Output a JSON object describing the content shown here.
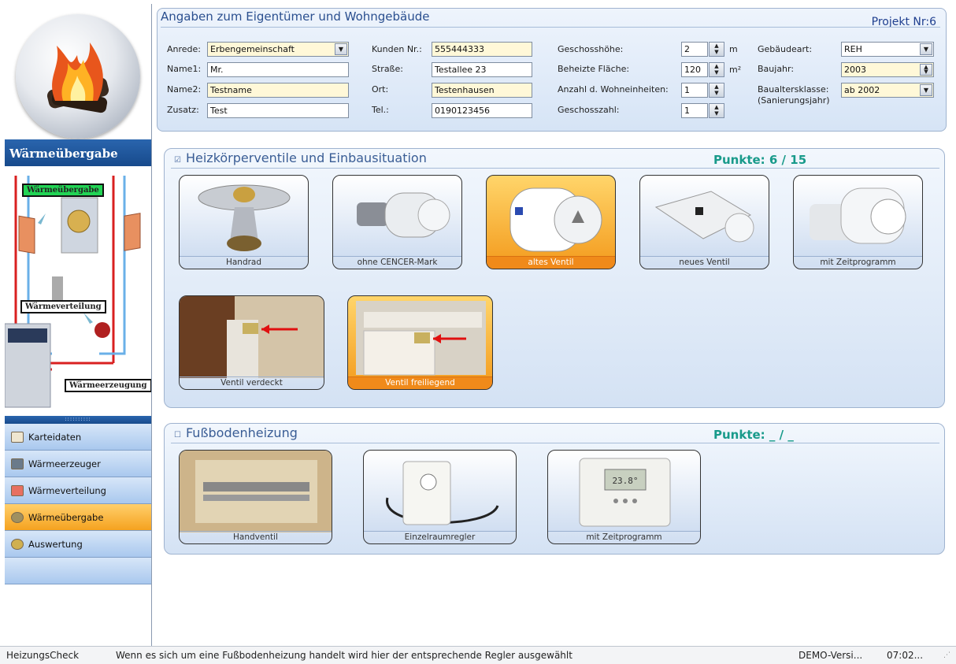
{
  "owner": {
    "title": "Angaben zum Eigentümer und Wohngebäude",
    "project": "Projekt Nr:6",
    "anrede_label": "Anrede:",
    "anrede_value": "Erbengemeinschaft",
    "name1_label": "Name1:",
    "name1_value": "Mr.",
    "name2_label": "Name2:",
    "name2_value": "Testname",
    "zusatz_label": "Zusatz:",
    "zusatz_value": "Test",
    "kunden_label": "Kunden Nr.:",
    "kunden_value": "555444333",
    "strasse_label": "Straße:",
    "strasse_value": "Testallee 23",
    "ort_label": "Ort:",
    "ort_value": "Testenhausen",
    "tel_label": "Tel.:",
    "tel_value": "0190123456",
    "geschosshoehe_label": "Geschosshöhe:",
    "geschosshoehe_value": "2",
    "geschosshoehe_unit": "m",
    "flaeche_label": "Beheizte Fläche:",
    "flaeche_value": "120",
    "flaeche_unit": "m²",
    "wohneinheiten_label": "Anzahl d. Wohneinheiten:",
    "wohneinheiten_value": "1",
    "geschosszahl_label": "Geschosszahl:",
    "geschosszahl_value": "1",
    "gebaeudeart_label": "Gebäudeart:",
    "gebaeudeart_value": "REH",
    "baujahr_label": "Baujahr:",
    "baujahr_value": "2003",
    "baualter_label": "Baualtersklasse:",
    "baualter_sub": "(Sanierungsjahr)",
    "baualter_value": "ab 2002"
  },
  "sidebar": {
    "header": "Wärmeübergabe",
    "diagram_labels": {
      "uebergabe": "Wärmeübergabe",
      "verteilung": "Wärmeverteilung",
      "erzeugung": "Wärmeerzeugung"
    },
    "grip": "::::::::::",
    "items": [
      {
        "label": "Karteidaten",
        "icon": "card-index-icon"
      },
      {
        "label": "Wärmeerzeuger",
        "icon": "boiler-icon"
      },
      {
        "label": "Wärmeverteilung",
        "icon": "pipe-distribution-icon"
      },
      {
        "label": "Wärmeübergabe",
        "icon": "radiator-valve-icon",
        "active": true
      },
      {
        "label": "Auswertung",
        "icon": "evaluation-icon"
      }
    ]
  },
  "heizkoerper": {
    "title": "Heizkörperventile und Einbausituation",
    "score": "Punkte: 6 / 15",
    "checked": true,
    "valves": [
      {
        "label": "Handrad",
        "selected": false
      },
      {
        "label": "ohne CENCER-Mark",
        "selected": false
      },
      {
        "label": "altes Ventil",
        "selected": true
      },
      {
        "label": "neues Ventil",
        "selected": false
      },
      {
        "label": "mit Zeitprogramm",
        "selected": false
      }
    ],
    "situation": [
      {
        "label": "Ventil verdeckt",
        "selected": false
      },
      {
        "label": "Ventil freiliegend",
        "selected": true
      }
    ]
  },
  "fussboden": {
    "title": "Fußbodenheizung",
    "score": "Punkte: _ / _",
    "checked": false,
    "items": [
      {
        "label": "Handventil"
      },
      {
        "label": "Einzelraumregler"
      },
      {
        "label": "mit Zeitprogramm"
      }
    ],
    "thermostat_display": "23.8°"
  },
  "status": {
    "app": "HeizungsCheck",
    "message": "Wenn es sich um eine Fußbodenheizung handelt wird hier der entsprechende Regler ausgewählt",
    "version": "DEMO-Versi...",
    "time": "07:02..."
  }
}
